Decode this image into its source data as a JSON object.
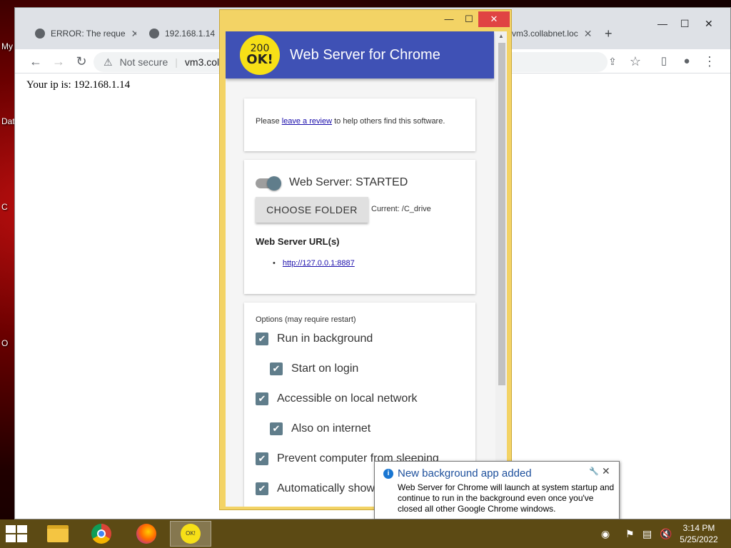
{
  "desktop": {
    "labels": [
      "My",
      "Dat",
      "C",
      "O"
    ]
  },
  "browser": {
    "tabs": [
      {
        "title": "ERROR: The reque",
        "close": "✕"
      },
      {
        "title": "192.168.1.14",
        "close": ""
      },
      {
        "title": "vm3.collabnet.loc",
        "close": "✕"
      }
    ],
    "new_tab": "+",
    "security_label": "Not secure",
    "url": "vm3.colla",
    "page_text": "Your ip is: 192.168.1.14"
  },
  "app": {
    "title": "Web Server for Chrome",
    "logo_line1": "200",
    "logo_line2": "OK!",
    "review_prefix": "Please ",
    "review_link": "leave a review",
    "review_suffix": " to help others find this software.",
    "server_status": "Web Server: STARTED",
    "choose_folder": "CHOOSE FOLDER",
    "current_folder": "Current: /C_drive",
    "urls_heading": "Web Server URL(s)",
    "url_bullet": "•",
    "server_url": "http://127.0.0.1:8887",
    "options_heading": "Options (may require restart)",
    "options": [
      {
        "label": "Run in background",
        "checked": true
      },
      {
        "label": "Start on login",
        "checked": true
      },
      {
        "label": "Accessible on local network",
        "checked": true
      },
      {
        "label": "Also on internet",
        "checked": true
      },
      {
        "label": "Prevent computer from sleeping",
        "checked": true
      },
      {
        "label": "Automatically show",
        "checked": true
      }
    ]
  },
  "notification": {
    "title": "New background app added",
    "body": "Web Server for Chrome will launch at system startup and continue to run in the background even once you've closed all other Google Chrome windows."
  },
  "taskbar": {
    "time": "3:14 PM",
    "date": "5/25/2022"
  },
  "colors": {
    "app_header": "#3f51b5",
    "app_frame": "#f3d365",
    "checkbox": "#607d8b",
    "taskbar": "#5c4a14"
  }
}
